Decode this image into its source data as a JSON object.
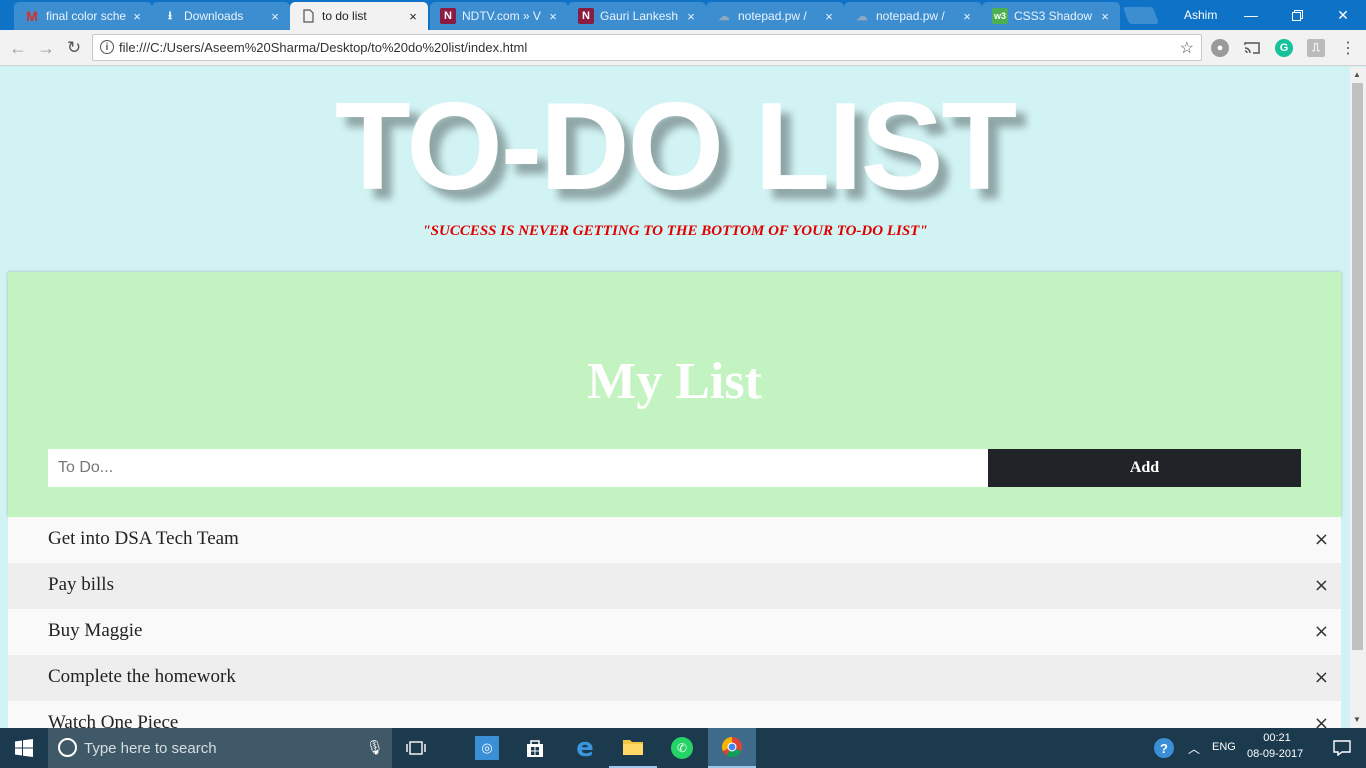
{
  "browser": {
    "tabs": [
      {
        "title": "final color sche",
        "favicon": "gmail-icon",
        "active": false
      },
      {
        "title": "Downloads",
        "favicon": "download-icon",
        "active": false
      },
      {
        "title": "to do list",
        "favicon": "document-icon",
        "active": true
      },
      {
        "title": "NDTV.com » V",
        "favicon": "ndtv-icon",
        "active": false
      },
      {
        "title": "Gauri Lankesh",
        "favicon": "ndtv-icon",
        "active": false
      },
      {
        "title": "notepad.pw / ",
        "favicon": "cloud-icon",
        "active": false
      },
      {
        "title": "notepad.pw / ",
        "favicon": "cloud-icon",
        "active": false
      },
      {
        "title": "CSS3 Shadow",
        "favicon": "w3-icon",
        "active": false
      }
    ],
    "tab_close": "×",
    "profile_name": "Ashim",
    "url": "file:///C:/Users/Aseem%20Sharma/Desktop/to%20do%20list/index.html",
    "accent": "#0e72c6"
  },
  "page": {
    "title": "TO-DO LIST",
    "quote": "\"SUCCESS IS NEVER GETTING TO THE BOTTOM OF YOUR TO-DO LIST\"",
    "list_heading": "My List",
    "input_placeholder": "To Do...",
    "input_value": "",
    "add_label": "Add",
    "close_glyph": "×",
    "items": [
      {
        "text": "Get into DSA Tech Team"
      },
      {
        "text": "Pay bills"
      },
      {
        "text": "Buy Maggie"
      },
      {
        "text": "Complete the homework"
      },
      {
        "text": "Watch One Piece"
      }
    ],
    "colors": {
      "background": "#d2f3f4",
      "header_green": "#c3f3c0",
      "quote_red": "#e00000",
      "add_button": "#202428"
    }
  },
  "taskbar": {
    "search_placeholder": "Type here to search",
    "language": "ENG",
    "time": "00:21",
    "date": "08-09-2017"
  }
}
